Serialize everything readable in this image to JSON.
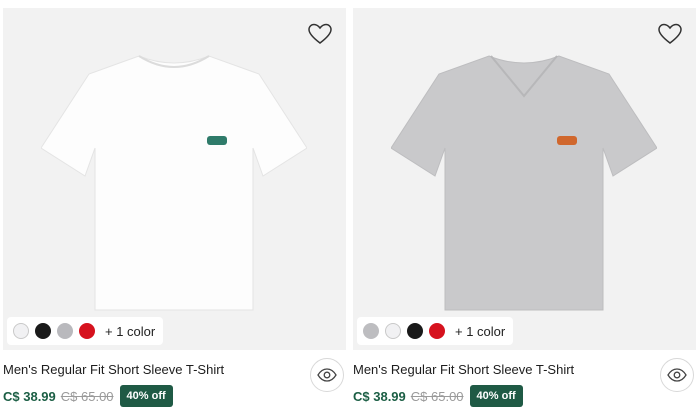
{
  "products": [
    {
      "name": "Men's Regular Fit Short Sleeve T-Shirt",
      "price": "C$ 38.99",
      "original_price": "C$ 65.00",
      "discount": "40% off",
      "more_colors": "+ 1 color",
      "shirt_color": "#fdfdfd",
      "logo_color": "#2f7b6a",
      "swatches": [
        "#f1f1f3",
        "#1a1a1a",
        "#b9b9bd",
        "#d6121e"
      ]
    },
    {
      "name": "Men's Regular Fit Short Sleeve T-Shirt",
      "price": "C$ 38.99",
      "original_price": "C$ 65.00",
      "discount": "40% off",
      "more_colors": "+ 1 color",
      "shirt_color": "#c9c9cb",
      "logo_color": "#d0672d",
      "swatches": [
        "#bdbdc0",
        "#f1f1f3",
        "#1a1a1a",
        "#d6121e"
      ]
    }
  ],
  "icons": {
    "wishlist": "heart-icon",
    "quick_view": "eye-icon"
  }
}
